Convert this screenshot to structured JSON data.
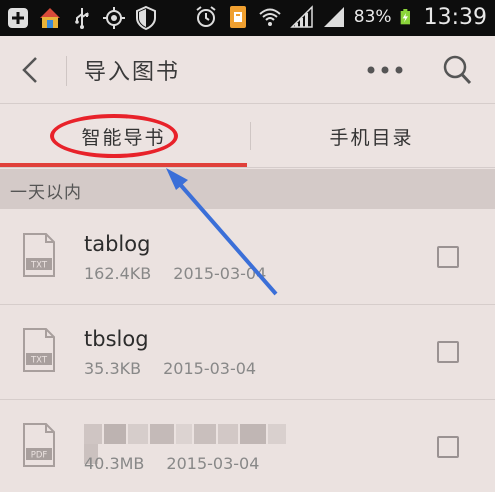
{
  "status_bar": {
    "battery_percent": "83%",
    "time": "13:39",
    "icons": [
      "add-icon",
      "home-icon",
      "usb-icon",
      "gps-icon",
      "shield-icon",
      "alarm-icon",
      "notification-icon",
      "wifi-icon",
      "signal-icon",
      "signal-icon",
      "battery-charging-icon"
    ]
  },
  "action_bar": {
    "title": "导入图书",
    "back_icon": "chevron-left-icon",
    "more_icon": "more-dots-icon",
    "search_icon": "search-icon"
  },
  "tabs": [
    {
      "label": "智能导书",
      "active": true
    },
    {
      "label": "手机目录",
      "active": false
    }
  ],
  "section": {
    "label": "一天以内"
  },
  "files": [
    {
      "name": "tablog",
      "size": "162.4KB",
      "date": "2015-03-04",
      "type": "TXT",
      "checked": false
    },
    {
      "name": "tbslog",
      "size": "35.3KB",
      "date": "2015-03-04",
      "type": "TXT",
      "checked": false
    },
    {
      "name": "",
      "size": "40.3MB",
      "date": "2015-03-04",
      "type": "PDF",
      "checked": false
    }
  ],
  "colors": {
    "accent": "#e0403a",
    "background": "#ebe2e0",
    "annotation": "#e8222a",
    "arrow": "#3b6fd8"
  }
}
